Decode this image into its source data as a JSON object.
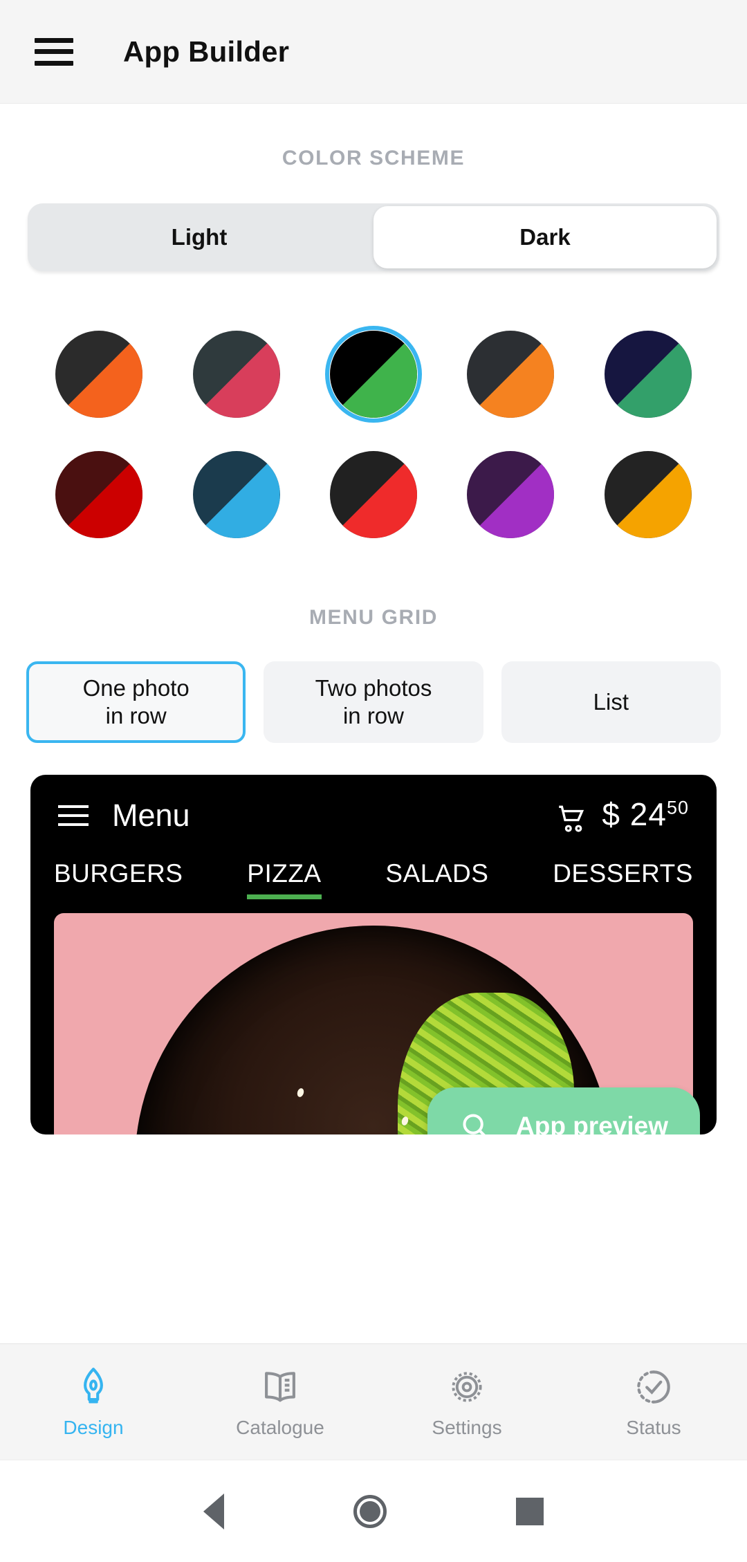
{
  "appbar": {
    "menu_icon": "hamburger-icon",
    "title": "App Builder"
  },
  "color_scheme": {
    "label": "COLOR SCHEME",
    "options": [
      {
        "label": "Light",
        "selected": false
      },
      {
        "label": "Dark",
        "selected": true
      }
    ],
    "selected": "Dark"
  },
  "palette": {
    "selected_index": 2,
    "selection_outline_color": "#3ab6f0",
    "swatches": [
      {
        "name": "dark-orange",
        "dark": "#2b2b2b",
        "accent": "#f4621d",
        "selected": false
      },
      {
        "name": "slate-crimson",
        "dark": "#2f3a3d",
        "accent": "#d83e5b",
        "selected": false
      },
      {
        "name": "black-green",
        "dark": "#000000",
        "accent": "#3fb34b",
        "selected": true
      },
      {
        "name": "charcoal-orange",
        "dark": "#2c2f33",
        "accent": "#f58220",
        "selected": false
      },
      {
        "name": "navy-emerald",
        "dark": "#161640",
        "accent": "#33a06a",
        "selected": false
      },
      {
        "name": "maroon-red",
        "dark": "#4a1010",
        "accent": "#cc0000",
        "selected": false
      },
      {
        "name": "deepblue-skyblue",
        "dark": "#1b3b4d",
        "accent": "#31ade3",
        "selected": false
      },
      {
        "name": "black-red",
        "dark": "#212121",
        "accent": "#ef2b2b",
        "selected": false
      },
      {
        "name": "eggplant-purple",
        "dark": "#3c1a4a",
        "accent": "#a12fc4",
        "selected": false
      },
      {
        "name": "black-amber",
        "dark": "#232323",
        "accent": "#f5a300",
        "selected": false
      }
    ]
  },
  "menu_grid": {
    "label": "MENU GRID",
    "options": [
      {
        "line1": "One photo",
        "line2": "in row",
        "selected": true
      },
      {
        "line1": "Two photos",
        "line2": "in row",
        "selected": false
      },
      {
        "line1": "List",
        "line2": "",
        "selected": false
      }
    ]
  },
  "preview": {
    "menu_icon": "hamburger-icon",
    "title": "Menu",
    "cart_icon": "shopping-cart-icon",
    "currency": "$",
    "price_whole": "24",
    "price_cents": "50",
    "tabs": [
      {
        "label": "BURGERS",
        "active": false
      },
      {
        "label": "PIZZA",
        "active": true
      },
      {
        "label": "SALADS",
        "active": false
      },
      {
        "label": "DESSERTS",
        "active": false
      }
    ],
    "active_tab_indicator_color": "#4caf50",
    "photo_alt": "noodle-beef-bowl-photo",
    "app_preview_button": {
      "label": "App preview",
      "icon": "search-icon",
      "background": "#7ed9a7"
    }
  },
  "bottom_nav": {
    "active_color": "#35b4f0",
    "inactive_color": "#8e9196",
    "items": [
      {
        "label": "Design",
        "icon": "pen-nib-icon",
        "active": true
      },
      {
        "label": "Catalogue",
        "icon": "book-icon",
        "active": false
      },
      {
        "label": "Settings",
        "icon": "gear-icon",
        "active": false
      },
      {
        "label": "Status",
        "icon": "check-circle-icon",
        "active": false
      }
    ]
  },
  "system_bar": {
    "back": "back-triangle-icon",
    "home": "home-circle-icon",
    "recents": "recents-square-icon"
  }
}
